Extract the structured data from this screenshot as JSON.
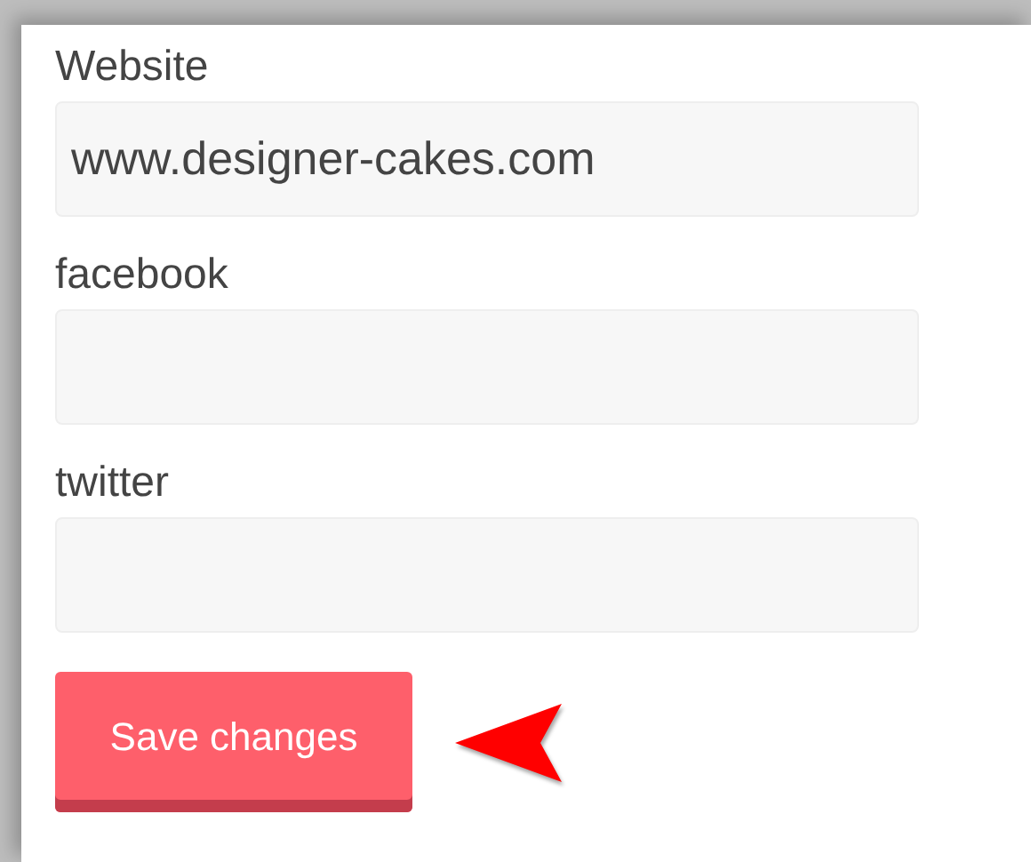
{
  "fields": [
    {
      "label": "Website",
      "value": "www.designer-cakes.com"
    },
    {
      "label": "facebook"
    },
    {
      "label": "twitter"
    }
  ],
  "save_button": {
    "label": "Save changes"
  }
}
